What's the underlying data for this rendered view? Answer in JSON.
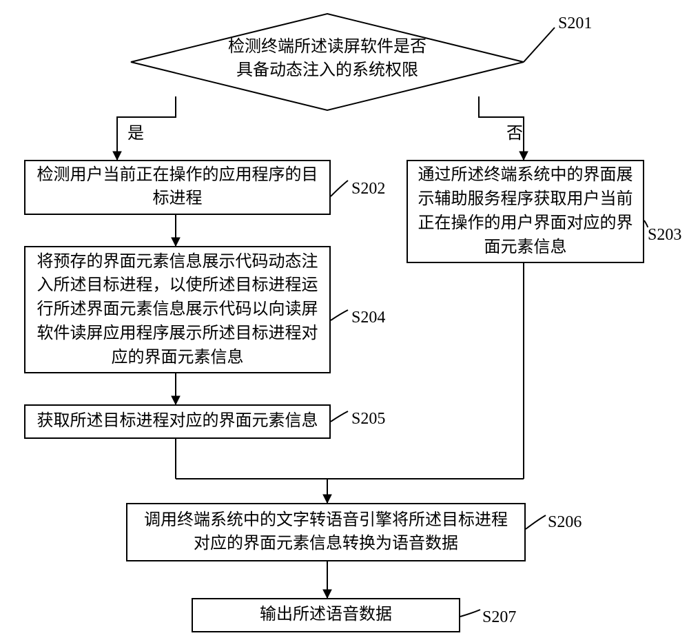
{
  "labels": {
    "s201": "S201",
    "s202": "S202",
    "s203": "S203",
    "s204": "S204",
    "s205": "S205",
    "s206": "S206",
    "s207": "S207",
    "yes": "是",
    "no": "否"
  },
  "nodes": {
    "decide": "检测终端所述读屏软件是否\n具备动态注入的系统权限",
    "s202": "检测用户当前正在操作的应用程序的目\n标进程",
    "s203": "通过所述终端系统中的界面展\n示辅助服务程序获取用户当前\n正在操作的用户界面对应的界\n面元素信息",
    "s204": "将预存的界面元素信息展示代码动态注\n入所述目标进程，以使所述目标进程运\n行所述界面元素信息展示代码以向读屏\n软件读屏应用程序展示所述目标进程对\n应的界面元素信息",
    "s205": "获取所述目标进程对应的界面元素信息",
    "s206": "调用终端系统中的文字转语音引擎将所述目标进程\n对应的界面元素信息转换为语音数据",
    "s207": "输出所述语音数据"
  },
  "chart_data": {
    "type": "flowchart",
    "nodes": [
      {
        "id": "S201",
        "type": "decision",
        "text": "检测终端所述读屏软件是否具备动态注入的系统权限"
      },
      {
        "id": "S202",
        "type": "process",
        "text": "检测用户当前正在操作的应用程序的目标进程"
      },
      {
        "id": "S203",
        "type": "process",
        "text": "通过所述终端系统中的界面展示辅助服务程序获取用户当前正在操作的用户界面对应的界面元素信息"
      },
      {
        "id": "S204",
        "type": "process",
        "text": "将预存的界面元素信息展示代码动态注入所述目标进程，以使所述目标进程运行所述界面元素信息展示代码以向读屏软件读屏应用程序展示所述目标进程对应的界面元素信息"
      },
      {
        "id": "S205",
        "type": "process",
        "text": "获取所述目标进程对应的界面元素信息"
      },
      {
        "id": "S206",
        "type": "process",
        "text": "调用终端系统中的文字转语音引擎将所述目标进程对应的界面元素信息转换为语音数据"
      },
      {
        "id": "S207",
        "type": "process",
        "text": "输出所述语音数据"
      }
    ],
    "edges": [
      {
        "from": "S201",
        "to": "S202",
        "label": "是"
      },
      {
        "from": "S201",
        "to": "S203",
        "label": "否"
      },
      {
        "from": "S202",
        "to": "S204"
      },
      {
        "from": "S204",
        "to": "S205"
      },
      {
        "from": "S205",
        "to": "S206"
      },
      {
        "from": "S203",
        "to": "S206"
      },
      {
        "from": "S206",
        "to": "S207"
      }
    ]
  }
}
